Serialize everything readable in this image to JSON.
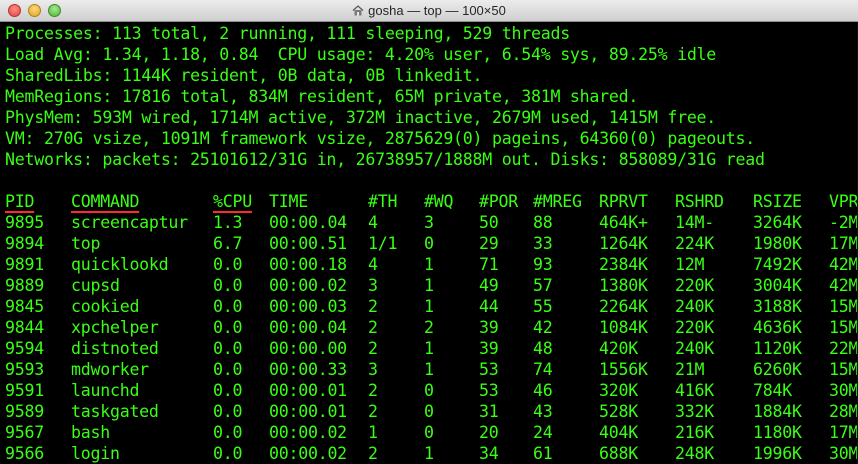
{
  "window": {
    "title": "gosha — top — 100×50"
  },
  "summary": [
    "Processes: 113 total, 2 running, 111 sleeping, 529 threads",
    "Load Avg: 1.34, 1.18, 0.84  CPU usage: 4.20% user, 6.54% sys, 89.25% idle",
    "SharedLibs: 1144K resident, 0B data, 0B linkedit.",
    "MemRegions: 17816 total, 834M resident, 65M private, 381M shared.",
    "PhysMem: 593M wired, 1714M active, 372M inactive, 2679M used, 1415M free.",
    "VM: 270G vsize, 1091M framework vsize, 2875629(0) pageins, 64360(0) pageouts.",
    "Networks: packets: 25101612/31G in, 26738957/1888M out. Disks: 858089/31G read"
  ],
  "colors": {
    "text": "#39ff14",
    "background": "#000000",
    "sort_underline": "#ff2a2a"
  },
  "table": {
    "columns": [
      "PID",
      "COMMAND",
      "%CPU",
      "TIME",
      "#TH",
      "#WQ",
      "#POR",
      "#MREG",
      "RPRVT",
      "RSHRD",
      "RSIZE",
      "VPR"
    ],
    "underlined_columns": [
      "PID",
      "COMMAND",
      "%CPU"
    ],
    "rows": [
      [
        "9895",
        "screencaptur",
        "1.3",
        "00:00.04",
        "4",
        "3",
        "50",
        "88",
        "464K+",
        "14M-",
        "3264K",
        "-2M"
      ],
      [
        "9894",
        "top",
        "6.7",
        "00:00.51",
        "1/1",
        "0",
        "29",
        "33",
        "1264K",
        "224K",
        "1980K",
        "17M"
      ],
      [
        "9891",
        "quicklookd",
        "0.0",
        "00:00.18",
        "4",
        "1",
        "71",
        "93",
        "2384K",
        "12M",
        "7492K",
        "42M"
      ],
      [
        "9889",
        "cupsd",
        "0.0",
        "00:00.02",
        "3",
        "1",
        "49",
        "57",
        "1380K",
        "220K",
        "3004K",
        "42M"
      ],
      [
        "9845",
        "cookied",
        "0.0",
        "00:00.03",
        "2",
        "1",
        "44",
        "55",
        "2264K",
        "240K",
        "3188K",
        "15M"
      ],
      [
        "9844",
        "xpchelper",
        "0.0",
        "00:00.04",
        "2",
        "2",
        "39",
        "42",
        "1084K",
        "220K",
        "4636K",
        "15M"
      ],
      [
        "9594",
        "distnoted",
        "0.0",
        "00:00.00",
        "2",
        "1",
        "39",
        "48",
        "420K",
        "240K",
        "1120K",
        "22M"
      ],
      [
        "9593",
        "mdworker",
        "0.0",
        "00:00.33",
        "3",
        "1",
        "53",
        "74",
        "1556K",
        "21M",
        "6260K",
        "15M"
      ],
      [
        "9591",
        "launchd",
        "0.0",
        "00:00.01",
        "2",
        "0",
        "53",
        "46",
        "320K",
        "416K",
        "784K",
        "30M"
      ],
      [
        "9589",
        "taskgated",
        "0.0",
        "00:00.01",
        "2",
        "0",
        "31",
        "43",
        "528K",
        "332K",
        "1884K",
        "28M"
      ],
      [
        "9567",
        "bash",
        "0.0",
        "00:00.02",
        "1",
        "0",
        "20",
        "24",
        "404K",
        "216K",
        "1180K",
        "17M"
      ],
      [
        "9566",
        "login",
        "0.0",
        "00:00.02",
        "2",
        "1",
        "34",
        "61",
        "688K",
        "248K",
        "1996K",
        "30M"
      ]
    ]
  }
}
